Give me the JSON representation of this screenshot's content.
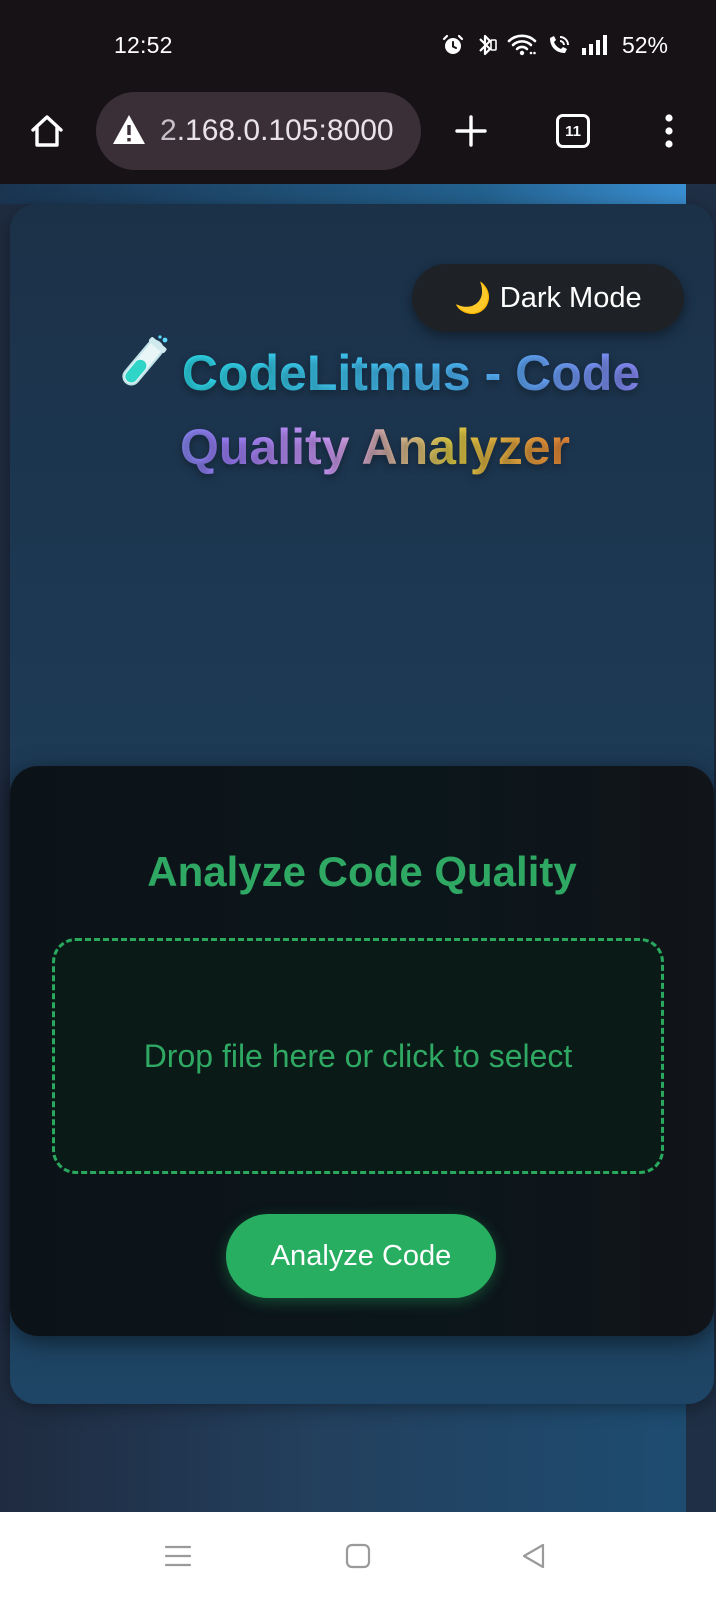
{
  "status_bar": {
    "time": "12:52",
    "battery": "52%",
    "icons": [
      "alarm-icon",
      "bluetooth-icon",
      "wifi-icon",
      "wifi-calling-icon",
      "signal-icon"
    ]
  },
  "browser": {
    "url_prefix": "2",
    "url_rest": ".168.0.105:8000",
    "tab_count": "11",
    "icons": [
      "home-icon",
      "warning-icon",
      "plus-icon",
      "tabs-icon",
      "menu-icon"
    ]
  },
  "page": {
    "dark_mode_label": "Dark Mode",
    "dark_mode_icon": "🌙",
    "title": "CodeLitmus - Code Quality Analyzer",
    "analyze_heading": "Analyze Code Quality",
    "drop_zone_text": "Drop file here or click to select",
    "analyze_button": "Analyze Code"
  },
  "colors": {
    "accent_green": "#27ae60",
    "heading_green": "#2ea863",
    "toggle_bg": "#1e2227"
  },
  "nav_bar": {
    "icons": [
      "recent-apps-icon",
      "home-square-icon",
      "back-icon"
    ]
  }
}
